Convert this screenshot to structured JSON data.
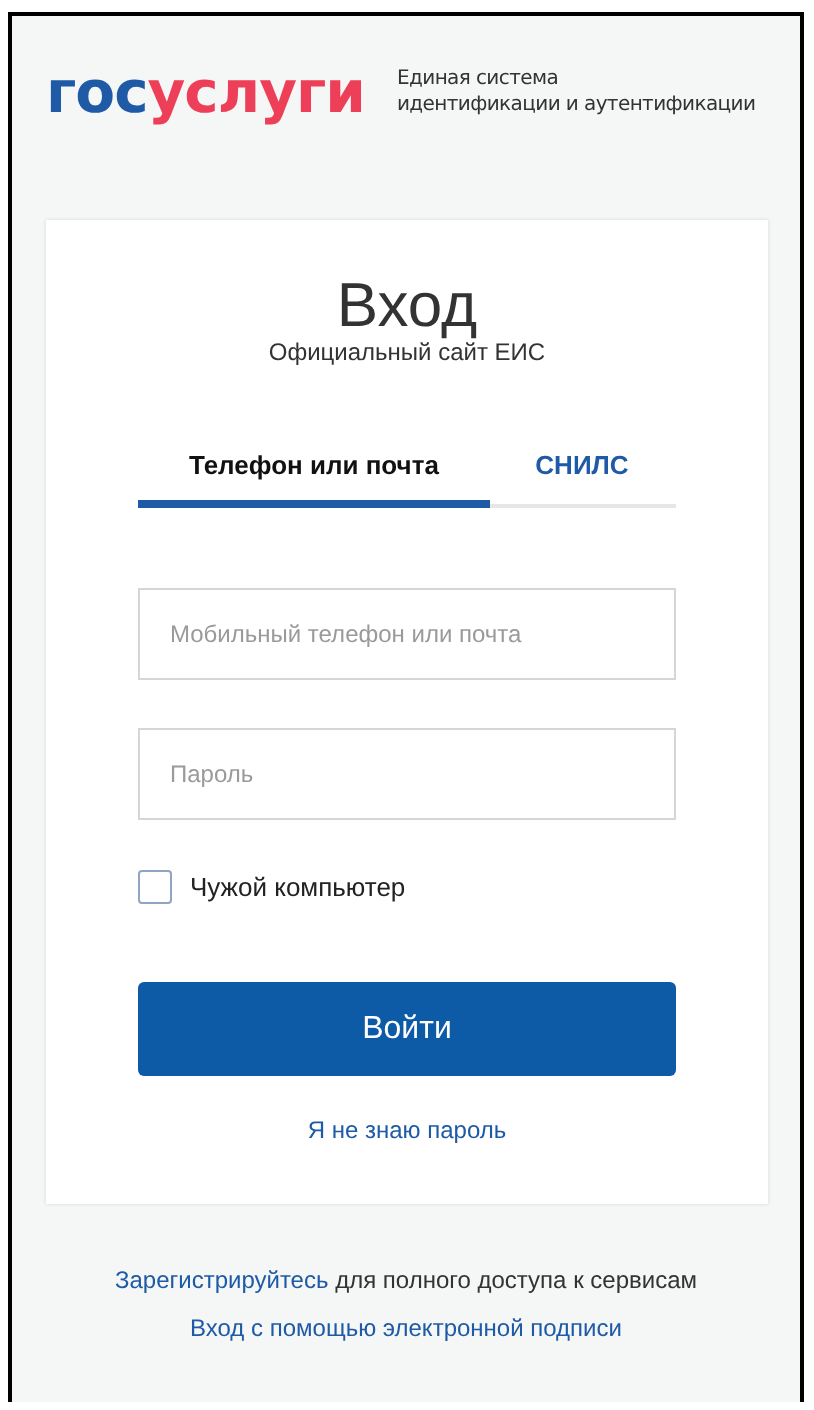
{
  "header": {
    "logo": [
      {
        "kind": "blue",
        "text": "гос"
      },
      {
        "kind": "red",
        "text": "услуги"
      }
    ],
    "tagline": [
      "Единая система",
      "идентификации и аутентификации"
    ]
  },
  "card": {
    "title": "Вход",
    "subtitle": "Официальный сайт ЕИС",
    "tabs": [
      {
        "label": "Телефон или почта",
        "selected": true
      },
      {
        "label": "СНИЛС",
        "selected": false
      }
    ],
    "fields": [
      {
        "placeholder": "Мобильный телефон или почта"
      },
      {
        "placeholder": "Пароль"
      }
    ],
    "checkbox": {
      "label": "Чужой компьютер",
      "checked": false
    },
    "button": "Войти",
    "forgot_link": "Я не знаю пароль"
  },
  "footer": {
    "register": {
      "link": "Зарегистрируйтесь",
      "text": " для полного доступа к сервисам"
    },
    "signature_link": "Вход с помощью электронной подписи"
  }
}
